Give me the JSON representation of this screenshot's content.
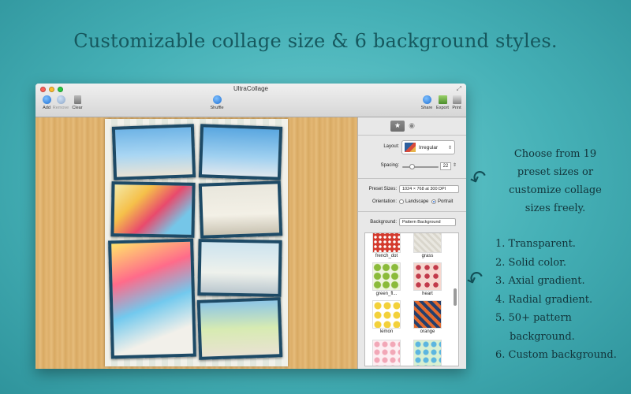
{
  "headline": "Customizable collage size & 6 background styles.",
  "window": {
    "title": "UltraCollage",
    "toolbar": {
      "add": "Add",
      "remove": "Remove",
      "clear": "Clear",
      "shuffle": "Shuffle",
      "share": "Share",
      "export": "Export",
      "print": "Print"
    }
  },
  "panel": {
    "layout_label": "Layout:",
    "layout_value": "Irregular",
    "spacing_label": "Spacing:",
    "spacing_value": "22",
    "spacing_level": 0.2,
    "preset_label": "Preset Sizes:",
    "preset_value": "1024 × 768 at 300 DPI",
    "orientation_label": "Orientation:",
    "orientation_options": [
      "Landscape",
      "Portrait"
    ],
    "orientation_selected": "Portrait",
    "background_label": "Background:",
    "background_value": "Pattern Background",
    "patterns": [
      "french_dot",
      "grass",
      "green_fl...",
      "heart",
      "lemon",
      "orange"
    ]
  },
  "side_text_1": [
    "Choose from 19",
    "preset sizes or",
    "customize collage",
    "sizes freely."
  ],
  "side_list": [
    "1. Transparent.",
    "2. Solid color.",
    "3. Axial gradient.",
    "4. Radial gradient.",
    "5. 50+ pattern",
    "background.",
    "6. Custom background."
  ],
  "icons": {
    "star": "star-icon",
    "eye": "eye-icon",
    "arrow": "curved-arrow-icon"
  }
}
